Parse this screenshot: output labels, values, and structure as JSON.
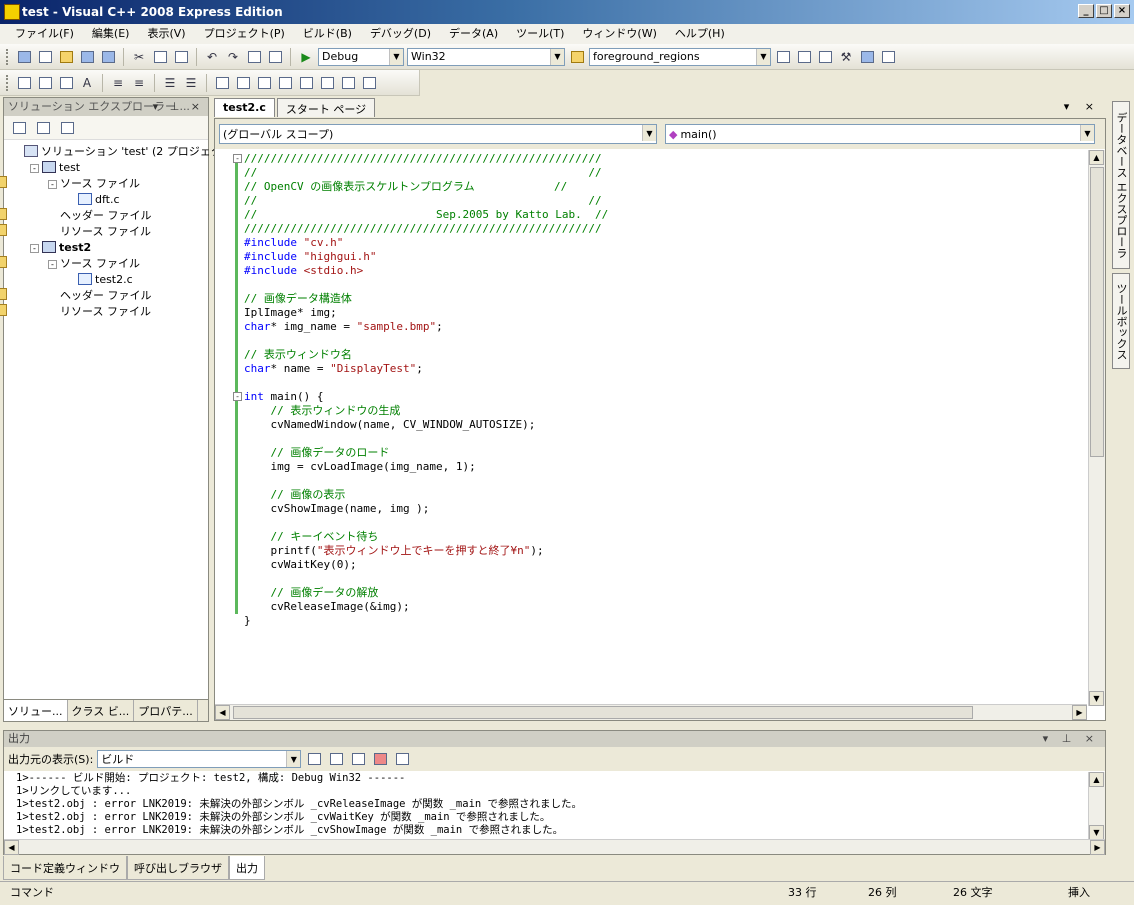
{
  "window": {
    "title": "test - Visual C++ 2008 Express Edition"
  },
  "menu": [
    "ファイル(F)",
    "編集(E)",
    "表示(V)",
    "プロジェクト(P)",
    "ビルド(B)",
    "デバッグ(D)",
    "データ(A)",
    "ツール(T)",
    "ウィンドウ(W)",
    "ヘルプ(H)"
  ],
  "toolbar": {
    "config": "Debug",
    "platform": "Win32",
    "find": "foreground_regions"
  },
  "solution_explorer": {
    "title": "ソリューション エクスプローラー ...",
    "tree": [
      {
        "label": "ソリューション 'test' (2 プロジェクト)",
        "level": 0,
        "icon": "solution-icon",
        "expander": ""
      },
      {
        "label": "test",
        "level": 1,
        "icon": "project-icon",
        "expander": "-"
      },
      {
        "label": "ソース ファイル",
        "level": 2,
        "icon": "folder-icon",
        "expander": "-"
      },
      {
        "label": "dft.c",
        "level": 3,
        "icon": "cpp-file-icon",
        "expander": ""
      },
      {
        "label": "ヘッダー ファイル",
        "level": 2,
        "icon": "folder-icon",
        "expander": ""
      },
      {
        "label": "リソース ファイル",
        "level": 2,
        "icon": "folder-icon",
        "expander": ""
      },
      {
        "label": "test2",
        "level": 1,
        "icon": "project-icon",
        "expander": "-",
        "bold": true
      },
      {
        "label": "ソース ファイル",
        "level": 2,
        "icon": "folder-icon",
        "expander": "-"
      },
      {
        "label": "test2.c",
        "level": 3,
        "icon": "cpp-file-icon",
        "expander": ""
      },
      {
        "label": "ヘッダー ファイル",
        "level": 2,
        "icon": "folder-icon",
        "expander": ""
      },
      {
        "label": "リソース ファイル",
        "level": 2,
        "icon": "folder-icon",
        "expander": ""
      }
    ],
    "tabs": [
      "ソリュー...",
      "クラス ビ...",
      "プロパテ..."
    ]
  },
  "editor": {
    "tabs": [
      "test2.c",
      "スタート ページ"
    ],
    "scope": "(グローバル スコープ)",
    "member": "main()",
    "lines": [
      [
        [
          "cm",
          "//////////////////////////////////////////////////////"
        ]
      ],
      [
        [
          "cm",
          "//                                                  //"
        ]
      ],
      [
        [
          "cm",
          "// OpenCV の画像表示スケルトンプログラム            //"
        ]
      ],
      [
        [
          "cm",
          "//                                                  //"
        ]
      ],
      [
        [
          "cm",
          "//                           Sep.2005 by Katto Lab.  //"
        ]
      ],
      [
        [
          "cm",
          "//////////////////////////////////////////////////////"
        ]
      ],
      [
        [
          "pp",
          "#include "
        ],
        [
          "st",
          "\"cv.h\""
        ]
      ],
      [
        [
          "pp",
          "#include "
        ],
        [
          "st",
          "\"highgui.h\""
        ]
      ],
      [
        [
          "pp",
          "#include "
        ],
        [
          "st",
          "<stdio.h>"
        ]
      ],
      [
        [
          "tx",
          ""
        ]
      ],
      [
        [
          "cm",
          "// 画像データ構造体"
        ]
      ],
      [
        [
          "tx",
          "IplImage* img;"
        ]
      ],
      [
        [
          "kw",
          "char"
        ],
        [
          "tx",
          "* img_name = "
        ],
        [
          "st",
          "\"sample.bmp\""
        ],
        [
          "tx",
          ";"
        ]
      ],
      [
        [
          "tx",
          ""
        ]
      ],
      [
        [
          "cm",
          "// 表示ウィンドウ名"
        ]
      ],
      [
        [
          "kw",
          "char"
        ],
        [
          "tx",
          "* name = "
        ],
        [
          "st",
          "\"DisplayTest\""
        ],
        [
          "tx",
          ";"
        ]
      ],
      [
        [
          "tx",
          ""
        ]
      ],
      [
        [
          "kw",
          "int"
        ],
        [
          "tx",
          " main() {"
        ]
      ],
      [
        [
          "cm",
          "    // 表示ウィンドウの生成"
        ]
      ],
      [
        [
          "tx",
          "    cvNamedWindow(name, CV_WINDOW_AUTOSIZE);"
        ]
      ],
      [
        [
          "tx",
          ""
        ]
      ],
      [
        [
          "cm",
          "    // 画像データのロード"
        ]
      ],
      [
        [
          "tx",
          "    img = cvLoadImage(img_name, 1);"
        ]
      ],
      [
        [
          "tx",
          ""
        ]
      ],
      [
        [
          "cm",
          "    // 画像の表示"
        ]
      ],
      [
        [
          "tx",
          "    cvShowImage(name, img );"
        ]
      ],
      [
        [
          "tx",
          ""
        ]
      ],
      [
        [
          "cm",
          "    // キーイベント待ち"
        ]
      ],
      [
        [
          "tx",
          "    printf("
        ],
        [
          "st",
          "\"表示ウィンドウ上でキーを押すと終了¥n\""
        ],
        [
          "tx",
          ");"
        ]
      ],
      [
        [
          "tx",
          "    cvWaitKey(0);"
        ]
      ],
      [
        [
          "tx",
          ""
        ]
      ],
      [
        [
          "cm",
          "    // 画像データの解放"
        ]
      ],
      [
        [
          "tx",
          "    cvReleaseImage(&img);"
        ]
      ],
      [
        [
          "tx",
          "}"
        ]
      ]
    ]
  },
  "right_tabs": [
    "データベース エクスプローラ",
    "ツールボックス"
  ],
  "output": {
    "title": "出力",
    "source_label": "出力元の表示(S):",
    "source_value": "ビルド",
    "lines": [
      "1>------ ビルド開始: プロジェクト: test2, 構成: Debug Win32 ------",
      "1>リンクしています...",
      "1>test2.obj : error LNK2019: 未解決の外部シンボル _cvReleaseImage が関数 _main で参照されました。",
      "1>test2.obj : error LNK2019: 未解決の外部シンボル _cvWaitKey が関数 _main で参照されました。",
      "1>test2.obj : error LNK2019: 未解決の外部シンボル _cvShowImage が関数 _main で参照されました。"
    ]
  },
  "bottom_tabs": [
    "コード定義ウィンドウ",
    "呼び出しブラウザ",
    "出力"
  ],
  "status": {
    "left": "コマンド",
    "line": "33 行",
    "col": "26 列",
    "ch": "26 文字",
    "mode": "挿入"
  }
}
